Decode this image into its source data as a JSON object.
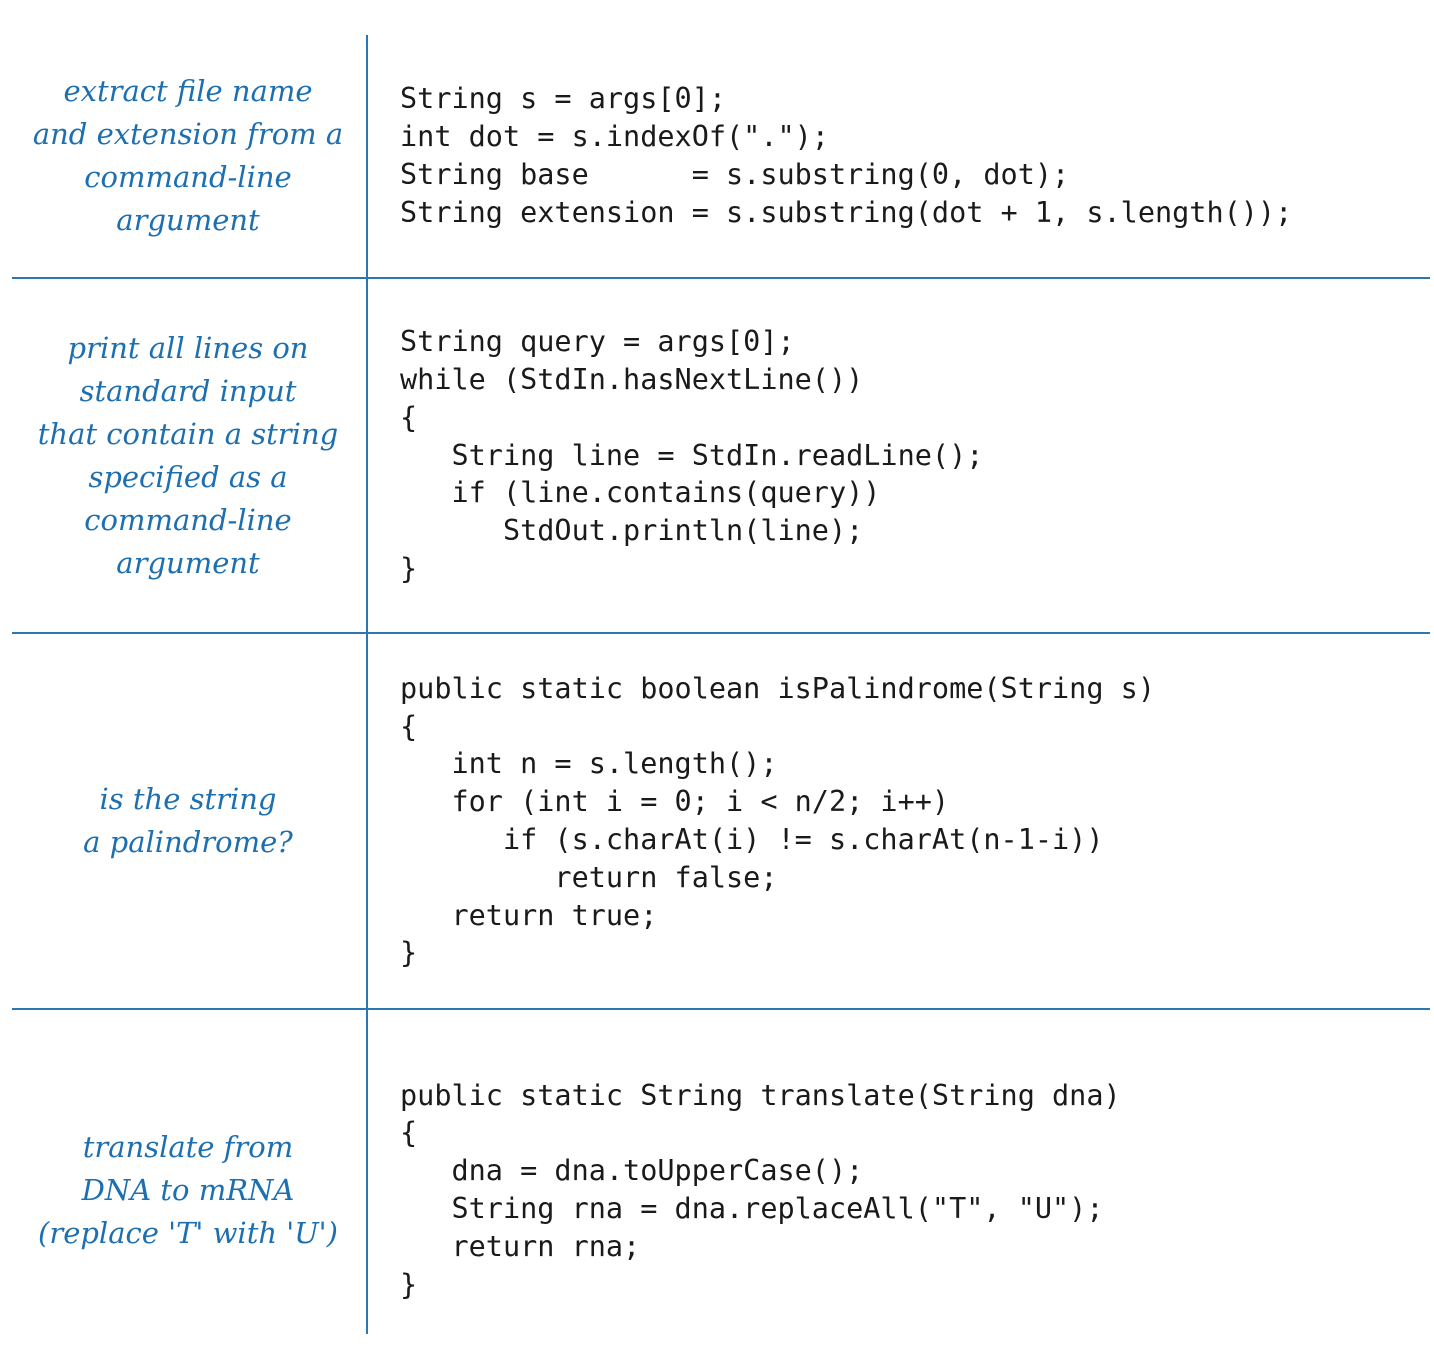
{
  "rows": [
    {
      "description": [
        "extract file name",
        "and extension from a",
        "command-line",
        "argument"
      ],
      "code": [
        "String s = args[0];",
        "int dot = s.indexOf(\".\");",
        "String base      = s.substring(0, dot);",
        "String extension = s.substring(dot + 1, s.length());"
      ]
    },
    {
      "description": [
        "print all lines on",
        "standard input",
        "that contain a string",
        "specified as a",
        "command-line",
        "argument"
      ],
      "code": [
        "String query = args[0];",
        "while (StdIn.hasNextLine())",
        "{",
        "   String line = StdIn.readLine();",
        "   if (line.contains(query))",
        "      StdOut.println(line);",
        "}"
      ]
    },
    {
      "description": [
        "is the string",
        "a palindrome?"
      ],
      "code": [
        "public static boolean isPalindrome(String s)",
        "{",
        "   int n = s.length();",
        "   for (int i = 0; i < n/2; i++)",
        "      if (s.charAt(i) != s.charAt(n-1-i))",
        "         return false;",
        "   return true;",
        "}"
      ]
    },
    {
      "description": [
        "translate from",
        "DNA to mRNA",
        "(replace 'T' with 'U')"
      ],
      "code": [
        "public static String translate(String dna)",
        "{",
        "   dna = dna.toUpperCase();",
        "   String rna = dna.replaceAll(\"T\", \"U\");",
        "   return rna;",
        "}"
      ]
    }
  ],
  "colors": {
    "accent": "#2a77b4",
    "description_text": "#1d6fb0",
    "code_text": "#1a1a1a"
  }
}
